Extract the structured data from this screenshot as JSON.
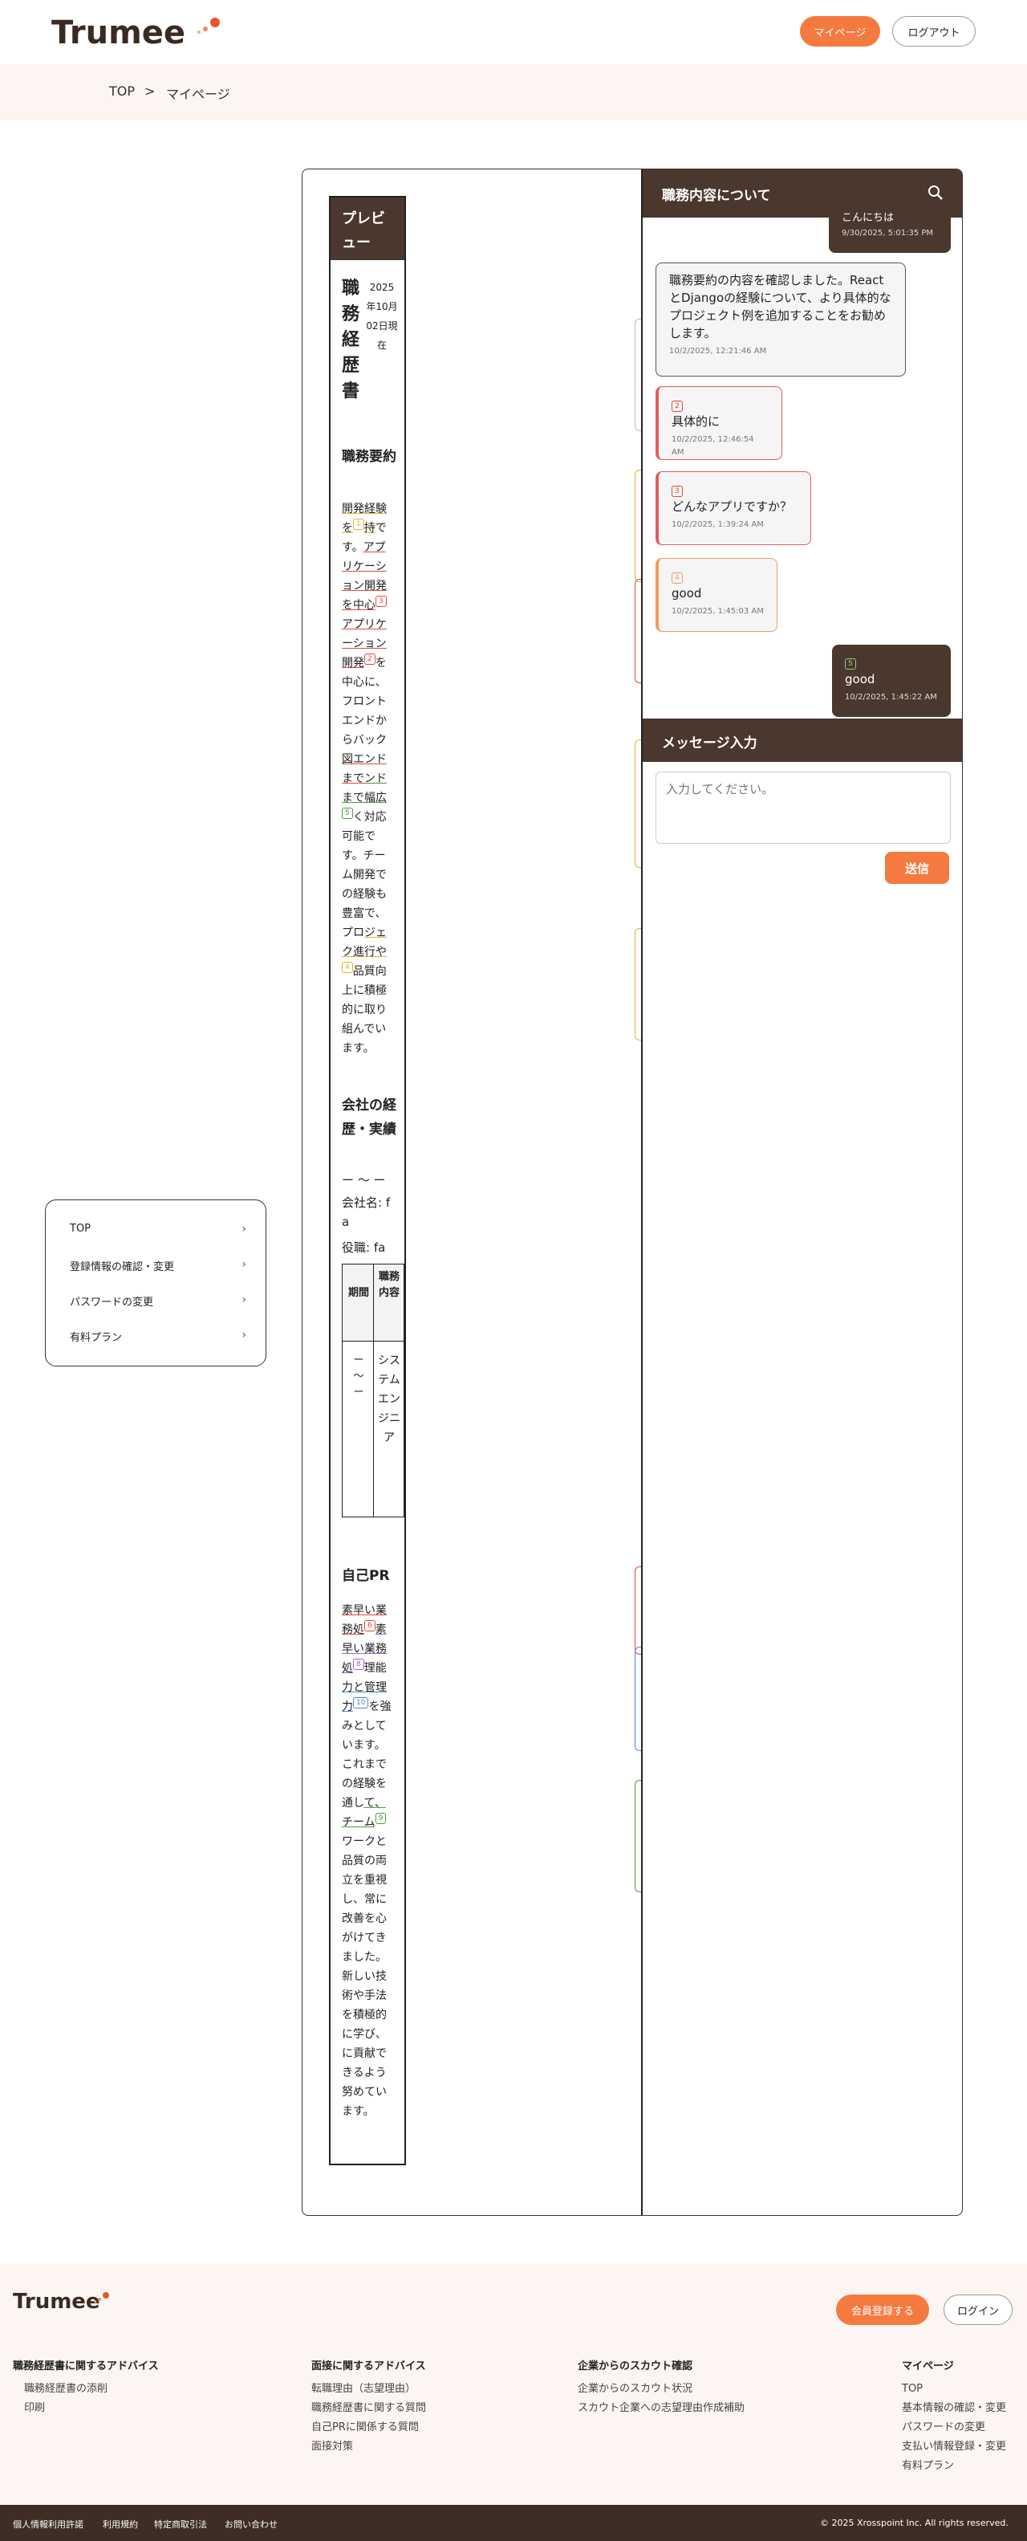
{
  "brand": {
    "logo": "Trumee",
    "accent": "#f57a40",
    "dark": "#4a372d"
  },
  "header": {
    "mypage_button": "マイページ",
    "logout_button": "ログアウト"
  },
  "breadcrumb": {
    "home": "TOP",
    "sep": ">",
    "current": "マイページ"
  },
  "side_menu": {
    "items": [
      {
        "label": "TOP"
      },
      {
        "label": "登録情報の確認・変更"
      },
      {
        "label": "パスワードの変更"
      },
      {
        "label": "有料プラン"
      }
    ]
  },
  "preview": {
    "header": "プレビュー",
    "doc_title": "職務経歴書",
    "doc_date": "2025年10月02日現在",
    "summary_title": "職務要約",
    "summary": {
      "p1": "開発経験を",
      "p2": "持",
      "p3": "です。",
      "p4": "アプリケーション開発を中心",
      "p5": "アプリケーション開発",
      "p6": "を中心に、フロントエンドからバック",
      "p7": "図",
      "p8": "エンドまで",
      "p9": "ンドまで幅広",
      "p10": "く対応可能です。チーム開発での経験も豊富で、プロ",
      "p11": "ジェク進行や",
      "p12": "品質向上に積極的に取り組んでいます。"
    },
    "career_title": "会社の経歴・実績",
    "career_period": "ー 〜 ー",
    "company": "会社名: fa",
    "role": "役職: fa",
    "table": {
      "col1": "期間",
      "col2": "職務内容",
      "period": "ー 〜 ー",
      "content": "システムエンジニア"
    },
    "pr_title": "自己PR",
    "pr": {
      "a": "素早い業務処",
      "b": "素早い業務処",
      "c": "理能",
      "d": "力と管理力",
      "e": "を強みとしています。これまでの経験を通し",
      "f": "て、チーム",
      "g": "ワークと品質の両立を重視し、常に改善を心がけてきました。新しい技術や手法を積極的に学び、に貢献できるよう努めています。"
    },
    "tags": {
      "t2": "2",
      "t3": "3",
      "t4": "4",
      "t5": "5",
      "t6": "6",
      "t10": "10",
      "t8": "8",
      "t9": "9",
      "t1": "1"
    }
  },
  "chat": {
    "title": "職務内容について",
    "messages": [
      {
        "type": "user",
        "text": "こんにちは",
        "ts": "9/30/2025, 5:01:35 PM"
      },
      {
        "type": "ai",
        "text": "職務要約の内容を確認しました。ReactとDjangoの経験について、より具体的なプロジェクト例を追加することをお勧めします。",
        "ts": "10/2/2025, 12:21:46 AM"
      },
      {
        "type": "warn",
        "num": "2",
        "text": "具体的に",
        "ts": "10/2/2025, 12:46:54 AM"
      },
      {
        "type": "warn",
        "num": "3",
        "text": "どんなアプリですか？",
        "ts": "10/2/2025, 1:39:24 AM"
      },
      {
        "type": "note",
        "num": "4",
        "text": "good",
        "ts": "10/2/2025, 1:45:03 AM"
      },
      {
        "type": "user",
        "num": "5",
        "text": "good",
        "ts": "10/2/2025, 1:45:22 AM"
      }
    ]
  },
  "message": {
    "title": "メッセージ入力",
    "placeholder": "入力してください。",
    "send": "送信"
  },
  "footer": {
    "logo": "Trumee",
    "register_button": "会員登録する",
    "login_button": "ログイン",
    "col1": {
      "title": "職務経歴書に関するアドバイス",
      "items": [
        "職務経歴書の添削",
        "印刷"
      ]
    },
    "col2": {
      "title": "面接に関するアドバイス",
      "items": [
        "転職理由（志望理由）",
        "職務経歴書に関する質問",
        "自己PRに関係する質問",
        "面接対策"
      ]
    },
    "col3": {
      "title": "企業からのスカウト確認",
      "items": [
        "企業からのスカウト状況",
        "スカウト企業への志望理由作成補助"
      ]
    },
    "col4": {
      "title": "マイページ",
      "items": [
        "TOP",
        "基本情報の確認・変更",
        "パスワードの変更",
        "支払い情報登録・変更",
        "有料プラン"
      ]
    },
    "bottom_links": [
      "個人情報利用許諾",
      "利用規約",
      "特定商取引法",
      "お問い合わせ"
    ],
    "copyright": "© 2025 Xrosspoint Inc. All rights reserved."
  }
}
